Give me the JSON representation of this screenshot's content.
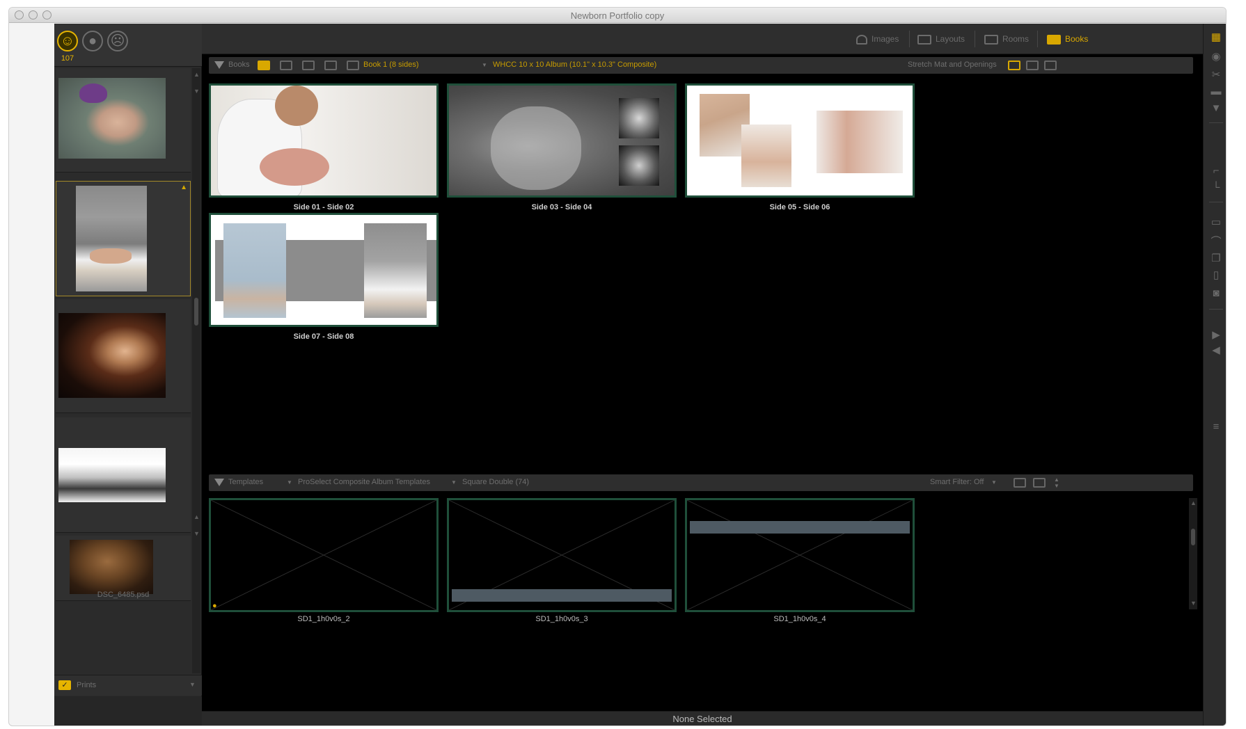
{
  "window": {
    "title": "Newborn Portfolio copy"
  },
  "rating": {
    "count": "107",
    "buttons": [
      {
        "icon": "happy-face-icon"
      },
      {
        "icon": "neutral-face-icon"
      },
      {
        "icon": "sad-face-icon"
      }
    ]
  },
  "filmstrip": {
    "last_caption": "DSC_6485.psd",
    "prints_label": "Prints"
  },
  "modes": {
    "images": "Images",
    "layouts": "Layouts",
    "rooms": "Rooms",
    "books": "Books"
  },
  "books_header": {
    "title": "Books",
    "book_name": "Book 1 (8 sides)",
    "album": "WHCC 10 x 10 Album  (10.1\" x 10.3\" Composite)",
    "stretch": "Stretch Mat and Openings"
  },
  "spreads": [
    {
      "label": "Side 01 - Side 02"
    },
    {
      "label": "Side 03 - Side 04"
    },
    {
      "label": "Side 05 - Side 06"
    },
    {
      "label": "Side 07 - Side 08"
    }
  ],
  "templates_header": {
    "title": "Templates",
    "collection": "ProSelect Composite Album Templates",
    "category": "Square Double (74)",
    "smart_filter": "Smart Filter: Off"
  },
  "templates": [
    {
      "label": "SD1_1h0v0s_2"
    },
    {
      "label": "SD1_1h0v0s_3"
    },
    {
      "label": "SD1_1h0v0s_4"
    }
  ],
  "status": "None Selected",
  "colors": {
    "accent": "#d9a800",
    "frame": "#1f4f3a",
    "panel": "#2e2e2e"
  }
}
